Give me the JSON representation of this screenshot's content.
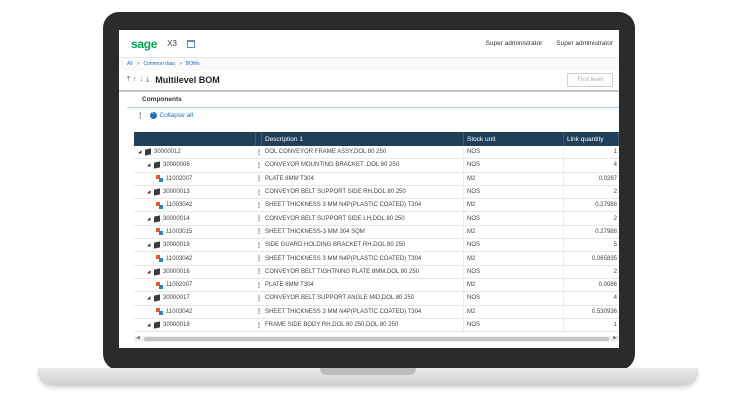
{
  "app": {
    "logo": "sage",
    "product": "X3",
    "user_links": [
      "Super administrator",
      "Super administrator"
    ]
  },
  "breadcrumb": [
    "All",
    "Common data",
    "BOMs"
  ],
  "page": {
    "title": "Multilevel BOM",
    "first_level_button": "First level"
  },
  "panel": {
    "title": "Components",
    "collapse_label": "Collapse all"
  },
  "grid": {
    "columns": [
      "Description 1",
      "Stock unit",
      "Link quantity"
    ],
    "rows": [
      {
        "code": "30000012",
        "description": "DOL CONVEYOR FRAME  ASSY,DOL 80 250",
        "unit": "NOS",
        "qty": "1"
      },
      {
        "code": "30000006",
        "description": "CONVEYOR MOUNTING BRACKET ,DOL 80 250",
        "unit": "NOS",
        "qty": "4"
      },
      {
        "code": "11002007",
        "description": "PLATE 8MM T304",
        "unit": "M2",
        "qty": "0.0267"
      },
      {
        "code": "30000013",
        "description": "CONVEYOR BELT SUPPORT SIDE RH,DOL 80 250",
        "unit": "NOS",
        "qty": "2"
      },
      {
        "code": "11003042",
        "description": "SHEET THICKNESS 3 MM N4P(PLASTIC COATED) T304",
        "unit": "M2",
        "qty": "0.27988"
      },
      {
        "code": "30000014",
        "description": "CONVEYOR BELT SUPPORT SIDE LH,DOL 80 250",
        "unit": "NOS",
        "qty": "2"
      },
      {
        "code": "11003015",
        "description": "SHEET THICKNESS-3 MM 304 SQM",
        "unit": "M2",
        "qty": "0.27988"
      },
      {
        "code": "30000019",
        "description": "SIDE GUARD HOLDING BRACKET RH,DOL 80 250",
        "unit": "NOS",
        "qty": "5"
      },
      {
        "code": "11003042",
        "description": "SHEET THICKNESS 3 MM N4P(PLASTIC COATED) T304",
        "unit": "M2",
        "qty": "0.065835"
      },
      {
        "code": "30000016",
        "description": "CONVEYOR BELT TIGHTNING PLATE 8MM,DOL 80 250",
        "unit": "NOS",
        "qty": "2"
      },
      {
        "code": "11002007",
        "description": "PLATE 8MM T304",
        "unit": "M2",
        "qty": "0.0086"
      },
      {
        "code": "30000017",
        "description": "CONVEYOR BELT SUPPORT ANGLE MID,DOL 80 250",
        "unit": "NOS",
        "qty": "4"
      },
      {
        "code": "11003042",
        "description": "SHEET THICKNESS 3 MM N4P(PLASTIC COATED) T304",
        "unit": "M2",
        "qty": "0.530936"
      },
      {
        "code": "30000018",
        "description": "FRAME SIDE BODY RH,DOL 80 250,DOL 80 250",
        "unit": "NOS",
        "qty": "1"
      }
    ]
  },
  "colors": {
    "brand": "#00a650",
    "header_bg": "#1e3f57",
    "link": "#1d70c4"
  }
}
